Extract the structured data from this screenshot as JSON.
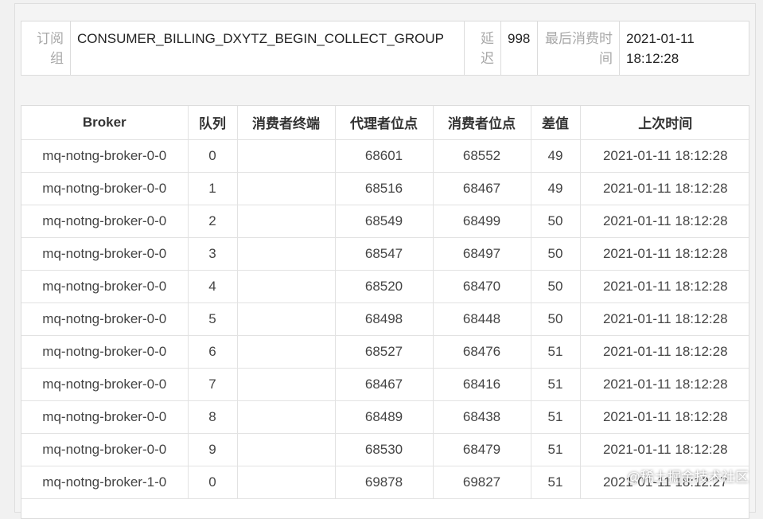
{
  "info": {
    "group_label": "订阅组",
    "group_value": "CONSUMER_BILLING_DXYTZ_BEGIN_COLLECT_GROUP",
    "delay_label": "延迟",
    "delay_value": "998",
    "last_consume_label": "最后消费时间",
    "last_consume_value": "2021-01-11 18:12:28"
  },
  "table": {
    "headers": [
      "Broker",
      "队列",
      "消费者终端",
      "代理者位点",
      "消费者位点",
      "差值",
      "上次时间"
    ],
    "rows": [
      [
        "mq-notng-broker-0-0",
        "0",
        "",
        "68601",
        "68552",
        "49",
        "2021-01-11 18:12:28"
      ],
      [
        "mq-notng-broker-0-0",
        "1",
        "",
        "68516",
        "68467",
        "49",
        "2021-01-11 18:12:28"
      ],
      [
        "mq-notng-broker-0-0",
        "2",
        "",
        "68549",
        "68499",
        "50",
        "2021-01-11 18:12:28"
      ],
      [
        "mq-notng-broker-0-0",
        "3",
        "",
        "68547",
        "68497",
        "50",
        "2021-01-11 18:12:28"
      ],
      [
        "mq-notng-broker-0-0",
        "4",
        "",
        "68520",
        "68470",
        "50",
        "2021-01-11 18:12:28"
      ],
      [
        "mq-notng-broker-0-0",
        "5",
        "",
        "68498",
        "68448",
        "50",
        "2021-01-11 18:12:28"
      ],
      [
        "mq-notng-broker-0-0",
        "6",
        "",
        "68527",
        "68476",
        "51",
        "2021-01-11 18:12:28"
      ],
      [
        "mq-notng-broker-0-0",
        "7",
        "",
        "68467",
        "68416",
        "51",
        "2021-01-11 18:12:28"
      ],
      [
        "mq-notng-broker-0-0",
        "8",
        "",
        "68489",
        "68438",
        "51",
        "2021-01-11 18:12:28"
      ],
      [
        "mq-notng-broker-0-0",
        "9",
        "",
        "68530",
        "68479",
        "51",
        "2021-01-11 18:12:28"
      ],
      [
        "mq-notng-broker-1-0",
        "0",
        "",
        "69878",
        "69827",
        "51",
        "2021-01-11 18:12:27"
      ]
    ]
  },
  "watermark": {
    "text": "@稀土掘金技术社区"
  }
}
